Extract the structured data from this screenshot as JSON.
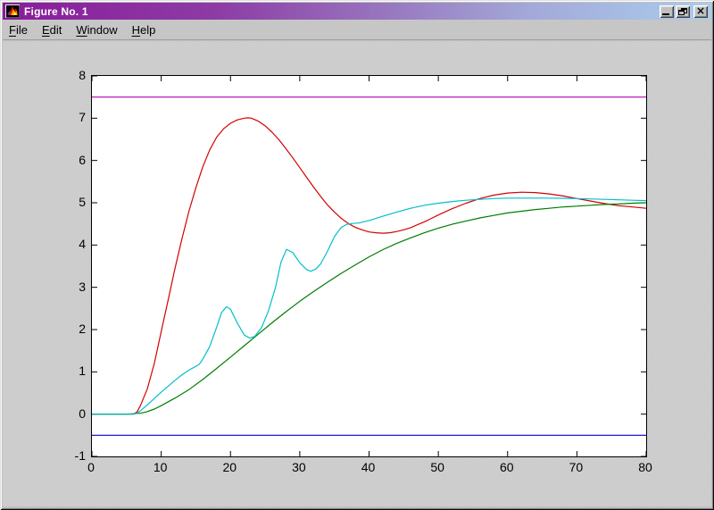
{
  "window": {
    "title": "Figure No. 1",
    "icon": "matlab-logo",
    "controls": {
      "minimize": "minimize",
      "restore": "restore",
      "close_glyph": "×"
    }
  },
  "menu": {
    "items": [
      {
        "label": "File"
      },
      {
        "label": "Edit"
      },
      {
        "label": "Window"
      },
      {
        "label": "Help"
      }
    ]
  },
  "colors": {
    "titlebar_left": "#891c9b",
    "titlebar_right": "#abcdec",
    "chrome": "#c0c0c0",
    "plot_background": "#ffffff"
  },
  "chart_data": {
    "type": "line",
    "title": "",
    "xlabel": "",
    "ylabel": "",
    "xlim": [
      0,
      80
    ],
    "ylim": [
      -1,
      8
    ],
    "x_ticks": [
      0,
      10,
      20,
      30,
      40,
      50,
      60,
      70,
      80
    ],
    "y_ticks": [
      -1,
      0,
      1,
      2,
      3,
      4,
      5,
      6,
      7,
      8
    ],
    "grid": false,
    "legend": null,
    "series": [
      {
        "name": "upper-bound-line",
        "color": "#b400b4",
        "x": [
          0,
          80
        ],
        "y": [
          7.5,
          7.5
        ]
      },
      {
        "name": "lower-bound-line",
        "color": "#0000cc",
        "x": [
          0,
          80
        ],
        "y": [
          -0.5,
          -0.5
        ]
      },
      {
        "name": "red-response",
        "color": "#d40000",
        "x": [
          0,
          4,
          6,
          6.5,
          7,
          8,
          9,
          10,
          11,
          12,
          13,
          14,
          15,
          16,
          17,
          18,
          19,
          20,
          21,
          22,
          22.5,
          23,
          24,
          25,
          26,
          27,
          28,
          29,
          30,
          31,
          32,
          33,
          34,
          35,
          36,
          37,
          38,
          39,
          40,
          41,
          42,
          43,
          44,
          45,
          46,
          47,
          48,
          49,
          50,
          52,
          54,
          56,
          58,
          60,
          62,
          64,
          66,
          68,
          70,
          72,
          74,
          76,
          78,
          80
        ],
        "y": [
          0,
          0,
          0,
          0.05,
          0.2,
          0.6,
          1.2,
          1.95,
          2.7,
          3.45,
          4.15,
          4.8,
          5.35,
          5.85,
          6.25,
          6.55,
          6.75,
          6.88,
          6.96,
          7.0,
          7.01,
          7.0,
          6.93,
          6.82,
          6.67,
          6.49,
          6.28,
          6.06,
          5.83,
          5.6,
          5.37,
          5.15,
          4.95,
          4.78,
          4.63,
          4.51,
          4.42,
          4.36,
          4.31,
          4.29,
          4.28,
          4.29,
          4.32,
          4.36,
          4.41,
          4.48,
          4.55,
          4.63,
          4.71,
          4.86,
          4.99,
          5.1,
          5.18,
          5.23,
          5.25,
          5.24,
          5.21,
          5.16,
          5.1,
          5.04,
          4.98,
          4.93,
          4.9,
          4.87
        ]
      },
      {
        "name": "green-response",
        "color": "#007d00",
        "x": [
          0,
          5,
          7,
          8,
          9,
          10,
          12,
          14,
          16,
          18,
          20,
          22,
          24,
          26,
          28,
          30,
          32,
          34,
          36,
          38,
          40,
          42,
          44,
          46,
          48,
          50,
          52,
          54,
          56,
          58,
          60,
          62,
          64,
          66,
          68,
          70,
          72,
          74,
          76,
          78,
          80
        ],
        "y": [
          0,
          0,
          0.02,
          0.06,
          0.12,
          0.2,
          0.38,
          0.58,
          0.82,
          1.08,
          1.35,
          1.62,
          1.89,
          2.16,
          2.42,
          2.67,
          2.9,
          3.12,
          3.33,
          3.53,
          3.72,
          3.89,
          4.04,
          4.17,
          4.29,
          4.4,
          4.49,
          4.57,
          4.64,
          4.7,
          4.76,
          4.8,
          4.84,
          4.87,
          4.9,
          4.92,
          4.94,
          4.96,
          4.97,
          4.99,
          5.0
        ]
      },
      {
        "name": "cyan-response",
        "color": "#00bfca",
        "x": [
          0,
          4,
          6,
          6.5,
          7,
          8,
          9,
          10,
          11,
          12,
          13,
          14,
          15,
          15.5,
          16,
          17,
          18,
          18.7,
          19.4,
          20,
          21,
          22,
          22.8,
          23.5,
          24.5,
          25.5,
          26.5,
          27.3,
          28.1,
          29,
          30,
          31,
          31.6,
          32.3,
          33,
          34,
          35,
          36,
          36.8,
          37.6,
          38.5,
          40,
          42,
          44,
          46,
          48,
          50,
          52,
          54,
          56,
          58,
          60,
          63,
          66,
          70,
          74,
          78,
          80
        ],
        "y": [
          0,
          0,
          0,
          0.02,
          0.08,
          0.22,
          0.37,
          0.52,
          0.66,
          0.8,
          0.93,
          1.04,
          1.13,
          1.18,
          1.3,
          1.6,
          2.05,
          2.4,
          2.54,
          2.48,
          2.15,
          1.87,
          1.8,
          1.84,
          2.05,
          2.45,
          3.0,
          3.6,
          3.9,
          3.82,
          3.58,
          3.42,
          3.38,
          3.43,
          3.55,
          3.85,
          4.2,
          4.42,
          4.49,
          4.51,
          4.52,
          4.58,
          4.68,
          4.78,
          4.87,
          4.94,
          4.99,
          5.03,
          5.06,
          5.08,
          5.1,
          5.11,
          5.11,
          5.11,
          5.1,
          5.08,
          5.06,
          5.05
        ]
      }
    ]
  }
}
